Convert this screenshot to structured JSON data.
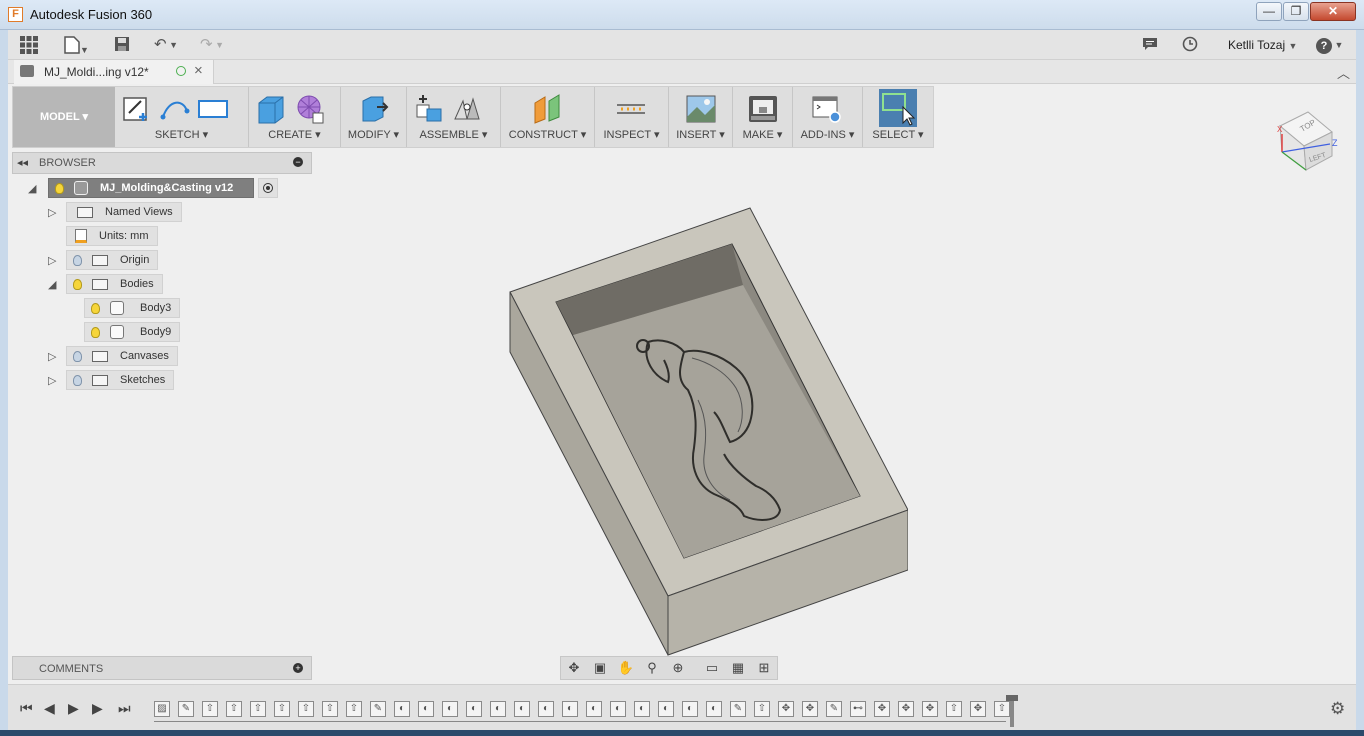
{
  "window": {
    "title": "Autodesk Fusion 360",
    "logo_letter": "F",
    "minimize": "—",
    "maximize": "❐",
    "close": "✕"
  },
  "quickbar": {
    "user": "Ketlli Tozaj",
    "help": "?"
  },
  "doc_tab": {
    "label": "MJ_Moldi...ing v12*"
  },
  "workspace": {
    "label": "MODEL"
  },
  "toolbar_groups": [
    {
      "label": "SKETCH"
    },
    {
      "label": "CREATE"
    },
    {
      "label": "MODIFY"
    },
    {
      "label": "ASSEMBLE"
    },
    {
      "label": "CONSTRUCT"
    },
    {
      "label": "INSPECT"
    },
    {
      "label": "INSERT"
    },
    {
      "label": "MAKE"
    },
    {
      "label": "ADD-INS"
    },
    {
      "label": "SELECT"
    }
  ],
  "viewcube": {
    "top": "TOP",
    "left": "LEFT",
    "axis_x": "X",
    "axis_z": "Z"
  },
  "browser": {
    "title": "BROWSER",
    "root": "MJ_Molding&Casting v12",
    "items": [
      {
        "label": "Named Views"
      },
      {
        "label": "Units: mm"
      },
      {
        "label": "Origin"
      },
      {
        "label": "Bodies"
      },
      {
        "label": "Body3"
      },
      {
        "label": "Body9"
      },
      {
        "label": "Canvases"
      },
      {
        "label": "Sketches"
      }
    ]
  },
  "comments": {
    "title": "COMMENTS"
  }
}
